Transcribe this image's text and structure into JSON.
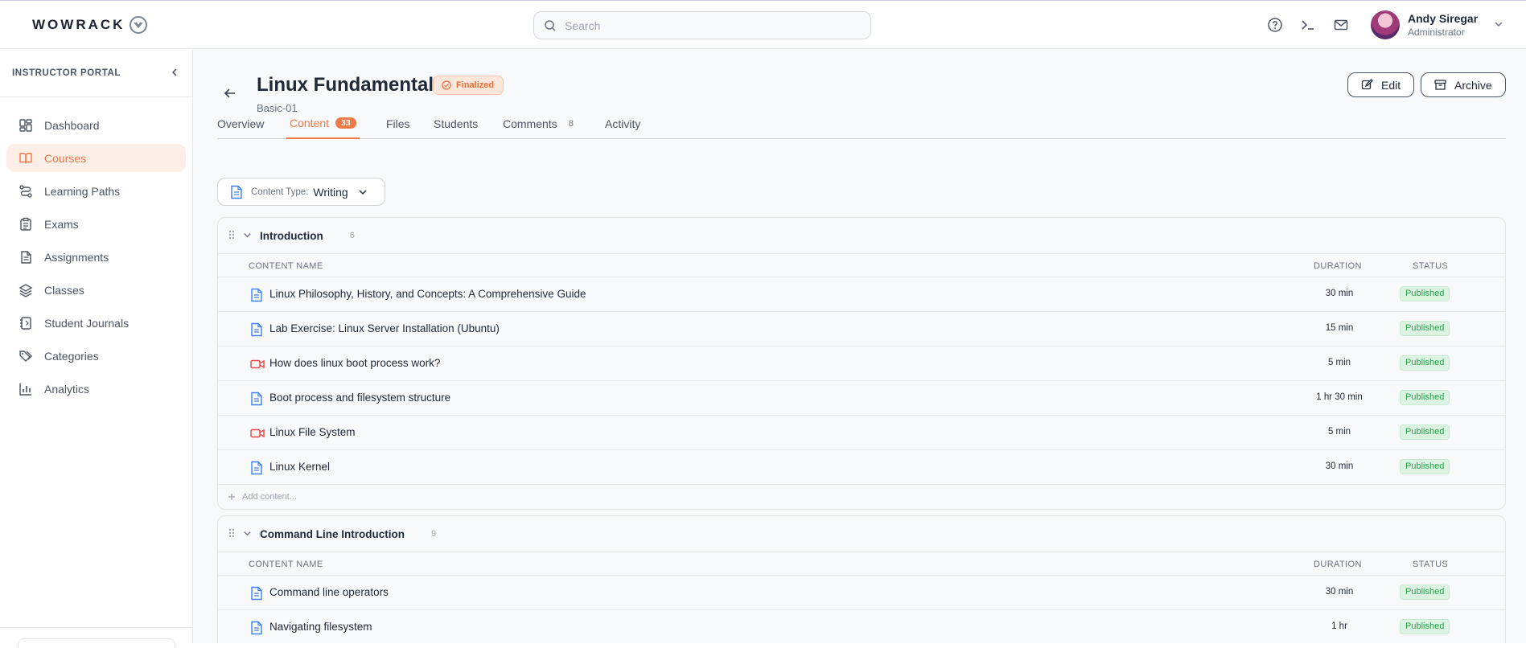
{
  "header": {
    "logo_text": "WOWRACK",
    "search_placeholder": "Search",
    "user": {
      "name": "Andy Siregar",
      "role": "Administrator"
    }
  },
  "sidebar": {
    "portal_title": "INSTRUCTOR PORTAL",
    "items": [
      {
        "label": "Dashboard",
        "icon": "dashboard-icon",
        "active": false
      },
      {
        "label": "Courses",
        "icon": "book-icon",
        "active": true
      },
      {
        "label": "Learning Paths",
        "icon": "route-icon",
        "active": false
      },
      {
        "label": "Exams",
        "icon": "clipboard-icon",
        "active": false
      },
      {
        "label": "Assignments",
        "icon": "document-icon",
        "active": false
      },
      {
        "label": "Classes",
        "icon": "layers-icon",
        "active": false
      },
      {
        "label": "Student Journals",
        "icon": "notebook-icon",
        "active": false
      },
      {
        "label": "Categories",
        "icon": "tags-icon",
        "active": false
      },
      {
        "label": "Analytics",
        "icon": "bar-chart-icon",
        "active": false
      }
    ]
  },
  "course": {
    "title": "Linux Fundamental",
    "status": "Finalized",
    "code": "Basic-01",
    "edit_label": "Edit",
    "archive_label": "Archive"
  },
  "tabs": [
    {
      "label": "Overview"
    },
    {
      "label": "Content",
      "count": "33",
      "active": true
    },
    {
      "label": "Files"
    },
    {
      "label": "Students"
    },
    {
      "label": "Comments",
      "count": "8"
    },
    {
      "label": "Activity"
    }
  ],
  "filter": {
    "label": "Content Type:",
    "value": "Writing"
  },
  "columns": {
    "name": "CONTENT NAME",
    "duration": "DURATION",
    "status": "STATUS"
  },
  "sections": [
    {
      "title": "Introduction",
      "count": "6",
      "add_label": "Add content...",
      "rows": [
        {
          "type": "document",
          "name": "Linux Philosophy, History, and Concepts: A Comprehensive Guide",
          "duration": "30 min",
          "status": "Published"
        },
        {
          "type": "document",
          "name": "Lab Exercise: Linux Server Installation (Ubuntu)",
          "duration": "15 min",
          "status": "Published"
        },
        {
          "type": "video",
          "name": "How does linux boot process work?",
          "duration": "5 min",
          "status": "Published"
        },
        {
          "type": "document",
          "name": "Boot process and filesystem structure",
          "duration": "1 hr 30 min",
          "status": "Published"
        },
        {
          "type": "video",
          "name": "Linux File System",
          "duration": "5 min",
          "status": "Published"
        },
        {
          "type": "document",
          "name": "Linux Kernel",
          "duration": "30 min",
          "status": "Published"
        }
      ]
    },
    {
      "title": "Command Line Introduction",
      "count": "9",
      "rows": [
        {
          "type": "document",
          "name": "Command line operators",
          "duration": "30 min",
          "status": "Published"
        },
        {
          "type": "document",
          "name": "Navigating filesystem",
          "duration": "1 hr",
          "status": "Published"
        }
      ]
    }
  ],
  "colors": {
    "accent": "#f07a47",
    "published": "#27a34b",
    "doc_icon": "#3b82f6",
    "video_icon": "#ef4444"
  }
}
